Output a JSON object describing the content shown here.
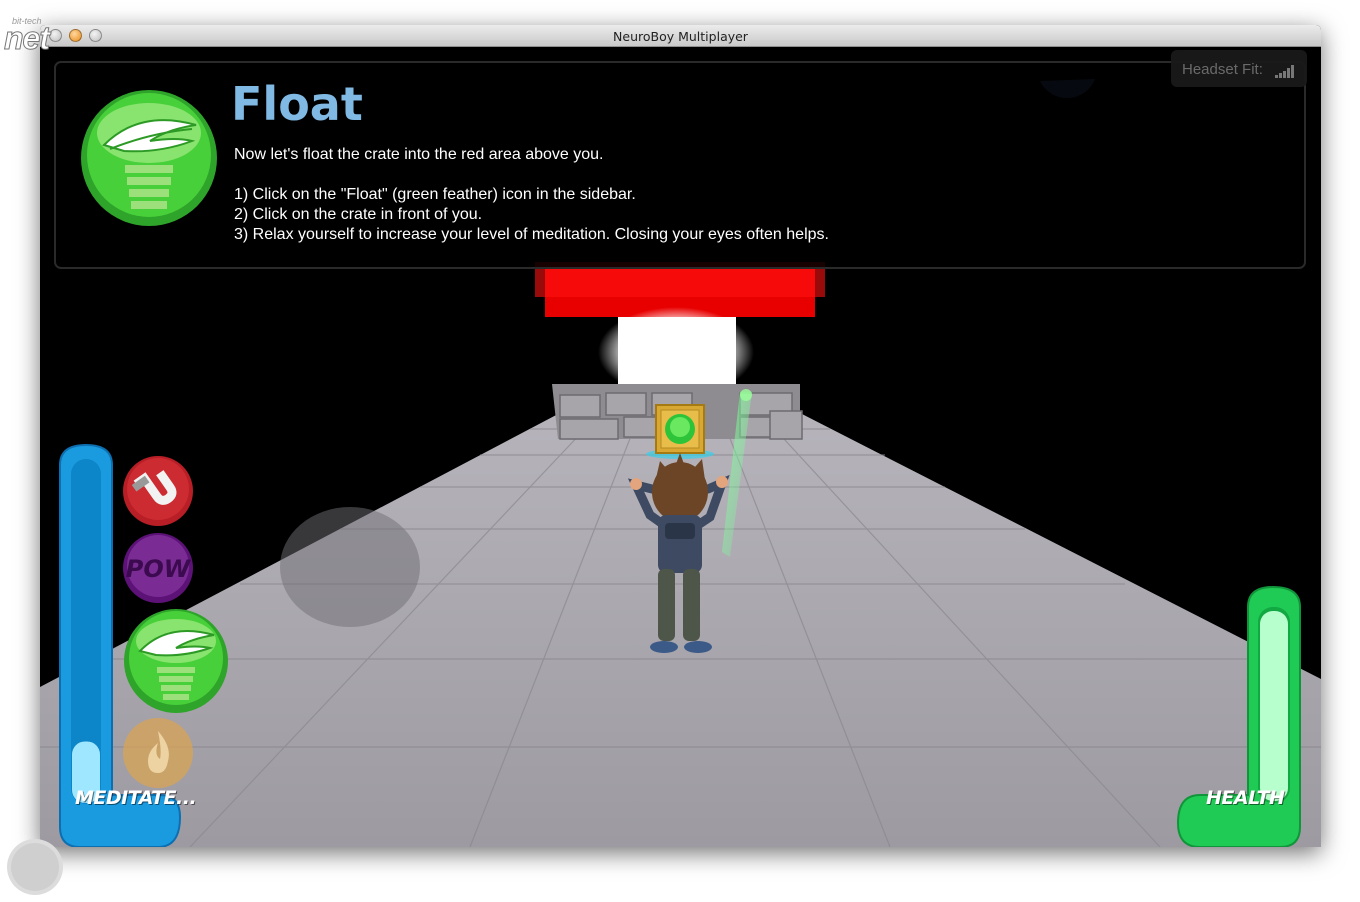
{
  "window": {
    "title": "NeuroBoy Multiplayer"
  },
  "tutorial": {
    "title": "Float",
    "intro": "Now let's float the crate into the red area above you.",
    "steps": [
      "1) Click on the \"Float\" (green feather) icon in the sidebar.",
      "2) Click on the crate in front of you.",
      "3) Relax yourself to increase your level of meditation. Closing your eyes often helps."
    ],
    "icon": "feather-icon"
  },
  "headset": {
    "label": "Headset Fit:",
    "icon": "signal-bars-icon"
  },
  "powers": [
    {
      "name": "magnet",
      "icon": "magnet-icon",
      "color": "#b81e26"
    },
    {
      "name": "pow",
      "label": "POW",
      "icon": "pow-icon",
      "color": "#6a1a82"
    },
    {
      "name": "float",
      "icon": "feather-icon",
      "color": "#3ec42a",
      "selected": true
    },
    {
      "name": "fire",
      "icon": "flame-icon",
      "color": "#d4a45a"
    }
  ],
  "meters": {
    "meditate": {
      "label": "MEDITATE...",
      "level": 0.18,
      "color": "#1aa3e6"
    },
    "health": {
      "label": "HEALTH",
      "level": 1.0,
      "color": "#1fca55"
    }
  },
  "watermark": {
    "small": "bit-tech",
    "large": "net"
  }
}
